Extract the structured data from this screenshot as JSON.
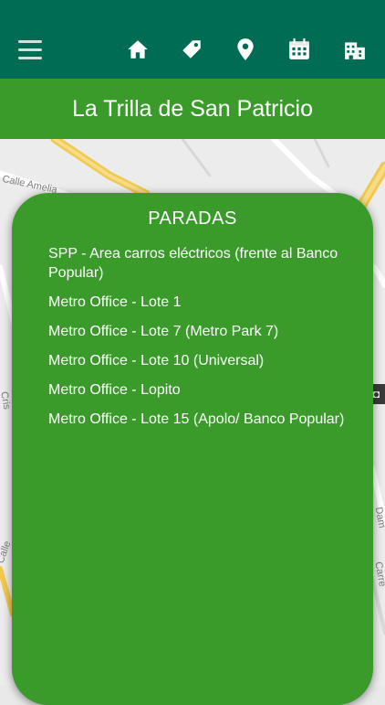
{
  "header": {
    "nav": [
      "home-icon",
      "tag-icon",
      "map-pin-icon",
      "calendar-icon",
      "building-icon"
    ]
  },
  "title": "La Trilla de San Patricio",
  "map": {
    "street_labels": [
      "Calle Amelia",
      "Cris",
      "Calle",
      "Dam",
      "Carre"
    ]
  },
  "stops_panel": {
    "heading": "PARADAS",
    "stops": [
      "SPP - Area carros eléctricos (frente al Banco Popular)",
      "Metro Office - Lote 1",
      "Metro Office - Lote 7 (Metro Park 7)",
      "Metro Office - Lote 10 (Universal)",
      "Metro Office - Lopito",
      "Metro Office - Lote 15 (Apolo/ Banco Popular)"
    ]
  },
  "colors": {
    "header": "#006c54",
    "title_bar": "#3a9b2b",
    "panel": "#3a9b2b",
    "icon": "#ffffff",
    "map_road": "#f2c94c"
  }
}
